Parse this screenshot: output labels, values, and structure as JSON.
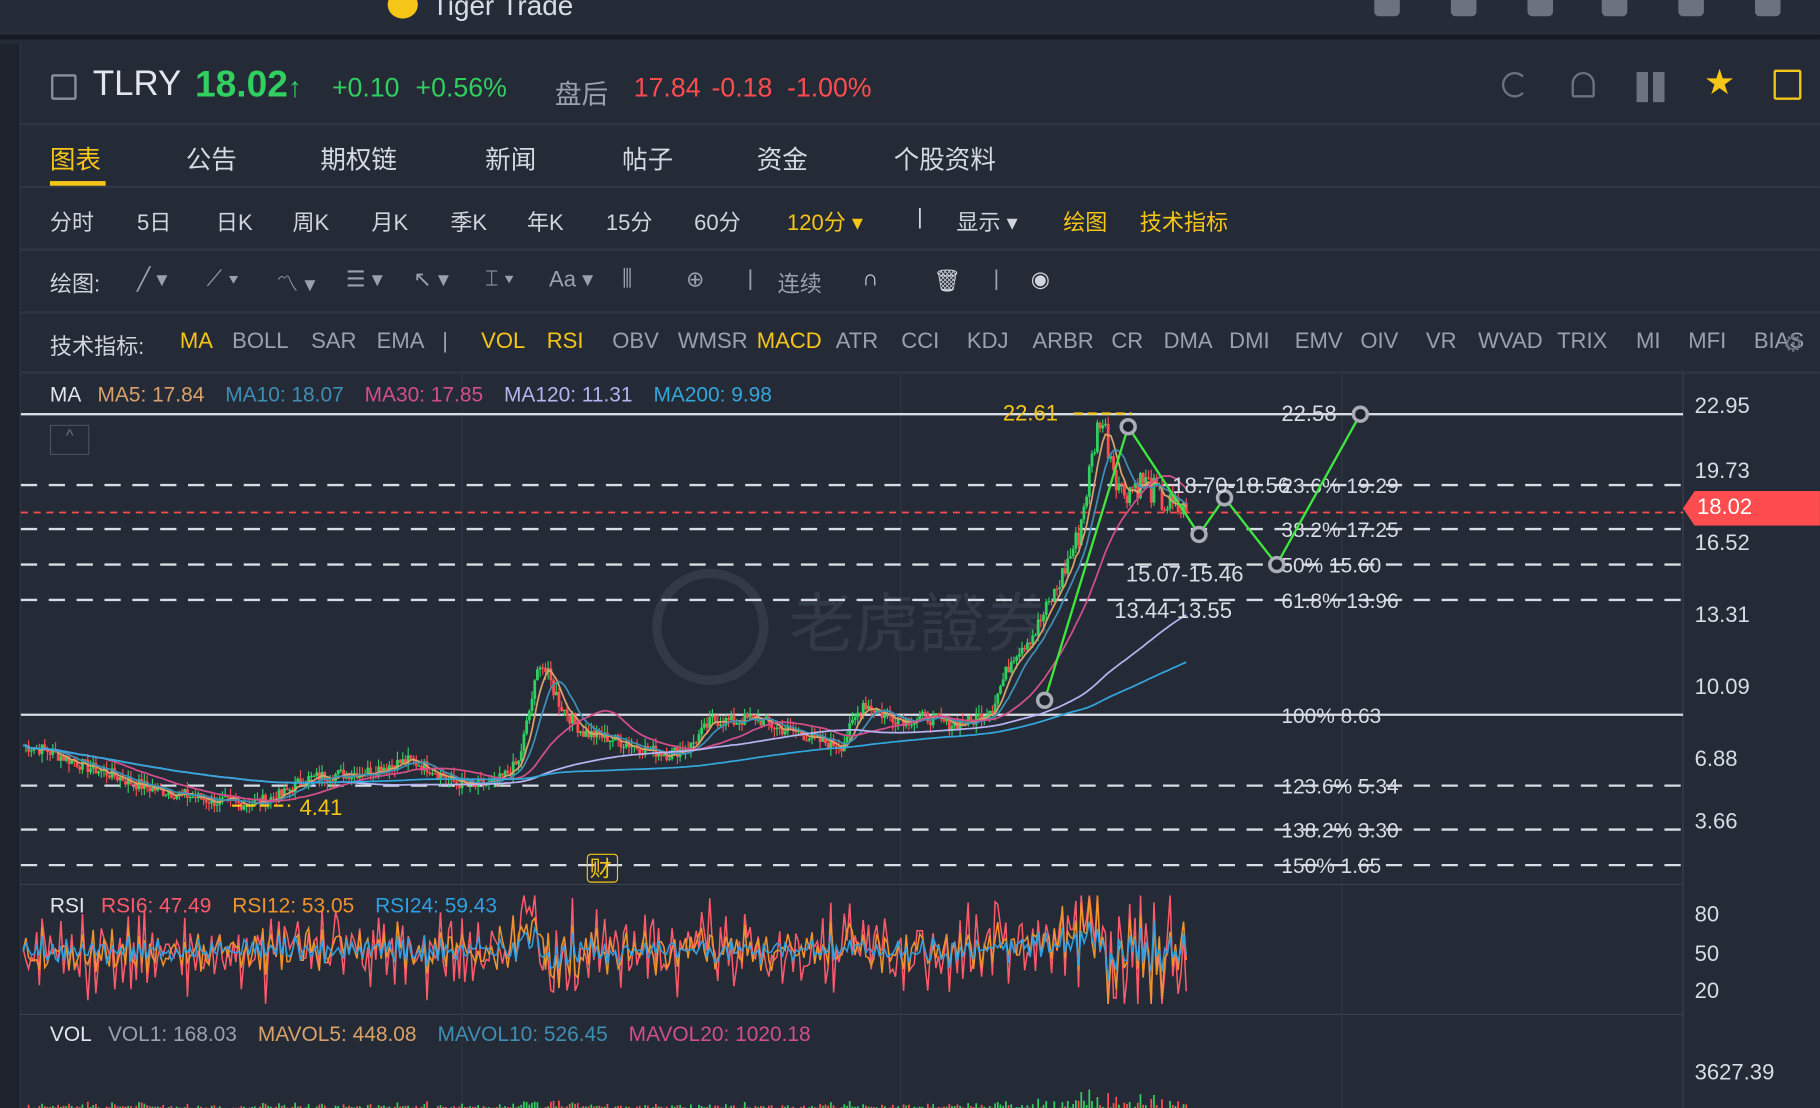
{
  "app": {
    "title": "Tiger Trade"
  },
  "quote": {
    "symbol": "TLRY",
    "price": "18.02",
    "arrow": "↑",
    "change": "+0.10",
    "change_pct": "+0.56%",
    "after_hours_label": "盘后",
    "ah_price": "17.84",
    "ah_change": "-0.18",
    "ah_change_pct": "-1.00%"
  },
  "tabs": [
    {
      "label": "图表",
      "active": true
    },
    {
      "label": "公告"
    },
    {
      "label": "期权链"
    },
    {
      "label": "新闻"
    },
    {
      "label": "帖子"
    },
    {
      "label": "资金"
    },
    {
      "label": "个股资料"
    }
  ],
  "periods": [
    {
      "label": "分时"
    },
    {
      "label": "5日"
    },
    {
      "label": "日K"
    },
    {
      "label": "周K"
    },
    {
      "label": "月K"
    },
    {
      "label": "季K"
    },
    {
      "label": "年K"
    },
    {
      "label": "15分"
    },
    {
      "label": "60分"
    },
    {
      "label": "120分 ▾",
      "active": true
    }
  ],
  "period_extra": {
    "display": "显示 ▾",
    "draw": "绘图",
    "indicators": "技术指标"
  },
  "draw_tools": {
    "label": "绘图:",
    "continuous": "连续",
    "font_label": "Aa"
  },
  "indicators": {
    "label": "技术指标:",
    "items": [
      {
        "label": "MA",
        "on": true
      },
      {
        "label": "BOLL"
      },
      {
        "label": "SAR"
      },
      {
        "label": "EMA"
      },
      {
        "label": "|"
      },
      {
        "label": "VOL",
        "on": true
      },
      {
        "label": "RSI",
        "on": true
      },
      {
        "label": "OBV"
      },
      {
        "label": "WMSR"
      },
      {
        "label": "MACD",
        "on": true
      },
      {
        "label": "ATR"
      },
      {
        "label": "CCI"
      },
      {
        "label": "KDJ"
      },
      {
        "label": "ARBR"
      },
      {
        "label": "CR"
      },
      {
        "label": "DMA"
      },
      {
        "label": "DMI"
      },
      {
        "label": "EMV"
      },
      {
        "label": "OIV"
      },
      {
        "label": "VR"
      },
      {
        "label": "WVAD"
      },
      {
        "label": "TRIX"
      },
      {
        "label": "MI"
      },
      {
        "label": "MFI"
      },
      {
        "label": "BIAS"
      }
    ]
  },
  "ma_legend": {
    "title": "MA",
    "items": [
      {
        "label": "MA5: 17.84",
        "color": "#d9a26a"
      },
      {
        "label": "MA10: 18.07",
        "color": "#3f8fb5"
      },
      {
        "label": "MA30: 17.85",
        "color": "#d24f8a"
      },
      {
        "label": "MA120: 11.31",
        "color": "#b7b2f0"
      },
      {
        "label": "MA200: 9.98",
        "color": "#33a6dc"
      }
    ]
  },
  "rsi_legend": {
    "title": "RSI",
    "items": [
      {
        "label": "RSI6: 47.49",
        "color": "#ff5a6a"
      },
      {
        "label": "RSI12: 53.05",
        "color": "#f0932b"
      },
      {
        "label": "RSI24: 59.43",
        "color": "#2f9fe0"
      }
    ]
  },
  "vol_legend": {
    "title": "VOL",
    "items": [
      {
        "label": "VOL1: 168.03",
        "color": "#9aa1ad"
      },
      {
        "label": "MAVOL5: 448.08",
        "color": "#d9a26a"
      },
      {
        "label": "MAVOL10: 526.45",
        "color": "#3f8fb5"
      },
      {
        "label": "MAVOL20: 1020.18",
        "color": "#d24f8a"
      }
    ]
  },
  "price_axis": [
    "22.95",
    "19.73",
    "16.52",
    "13.31",
    "10.09",
    "6.88",
    "3.66"
  ],
  "rsi_axis": [
    "80",
    "50",
    "20"
  ],
  "vol_axis": "3627.39",
  "current_price_tag": "18.02",
  "annotations": {
    "high": "22.61",
    "low": "4.41",
    "zone1": "18.70-18.56",
    "zone2": "15.07-15.46",
    "zone3": "13.44-13.55",
    "point": "22.58",
    "earnings_badge": "财"
  },
  "fib_levels": [
    {
      "label": "23.6% 19.29",
      "price": 19.29
    },
    {
      "label": "38.2% 17.25",
      "price": 17.25
    },
    {
      "label": "50% 15.60",
      "price": 15.6
    },
    {
      "label": "61.8% 13.96",
      "price": 13.96
    },
    {
      "label": "100% 8.63",
      "price": 8.63
    },
    {
      "label": "123.6% 5.34",
      "price": 5.34
    },
    {
      "label": "138.2% 3.30",
      "price": 3.3
    },
    {
      "label": "150% 1.65",
      "price": 1.65
    }
  ],
  "watermark": "老虎證券",
  "chart_data": {
    "type": "candlestick",
    "ylim": [
      1.2,
      24
    ],
    "closes": [
      7.2,
      7.0,
      6.6,
      6.2,
      5.9,
      5.5,
      5.2,
      5.0,
      4.8,
      4.6,
      4.5,
      4.6,
      4.9,
      5.6,
      5.8,
      5.9,
      6.0,
      6.3,
      6.5,
      6.1,
      5.5,
      5.3,
      5.5,
      6.4,
      11.2,
      9.0,
      7.8,
      7.6,
      7.3,
      7.0,
      6.8,
      7.2,
      8.4,
      8.3,
      8.5,
      8.0,
      7.8,
      7.4,
      7.2,
      9.2,
      8.6,
      8.4,
      8.5,
      8.2,
      8.3,
      9.0,
      11.5,
      12.5,
      14.5,
      17.0,
      22.6,
      19.0,
      19.5,
      18.4,
      18.02
    ],
    "colors": {
      "up": "#2fd05f",
      "down": "#ff4d4f",
      "accent": "#f5c518"
    }
  }
}
